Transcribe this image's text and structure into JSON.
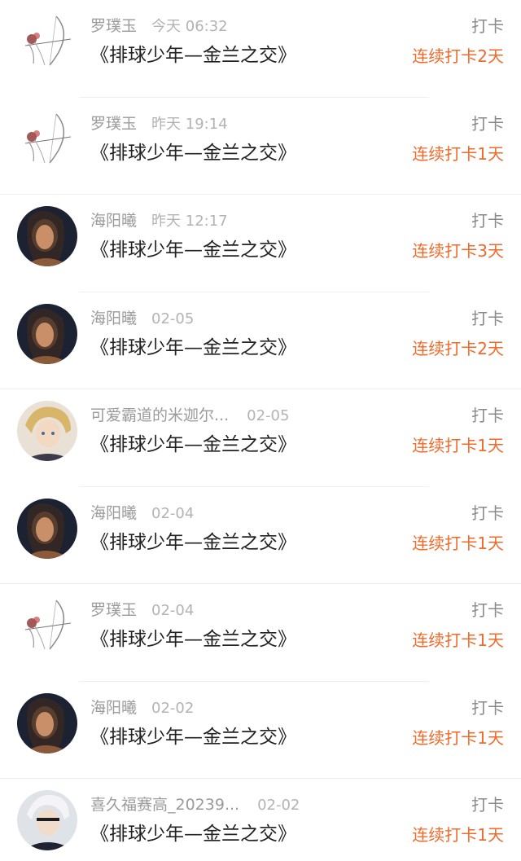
{
  "colors": {
    "streak": "#f06a2a",
    "meta": "#9a9a9a",
    "title": "#222222"
  },
  "records": [
    {
      "user": "罗璞玉",
      "time": "今天 06:32",
      "book": "《排球少年—金兰之交》",
      "type": "打卡",
      "streak": "连续打卡2天",
      "avatar": "archer-sketch-icon"
    },
    {
      "user": "罗璞玉",
      "time": "昨天 19:14",
      "book": "《排球少年—金兰之交》",
      "type": "打卡",
      "streak": "连续打卡1天",
      "avatar": "archer-sketch-icon"
    },
    {
      "user": "海阳曦",
      "time": "昨天 12:17",
      "book": "《排球少年—金兰之交》",
      "type": "打卡",
      "streak": "连续打卡3天",
      "avatar": "portrait-dark-icon"
    },
    {
      "user": "海阳曦",
      "time": "02-05",
      "book": "《排球少年—金兰之交》",
      "type": "打卡",
      "streak": "连续打卡2天",
      "avatar": "portrait-dark-icon"
    },
    {
      "user": "可爱霸道的米迦尔...",
      "time": "02-05",
      "book": "《排球少年—金兰之交》",
      "type": "打卡",
      "streak": "连续打卡1天",
      "avatar": "anime-blond-icon"
    },
    {
      "user": "海阳曦",
      "time": "02-04",
      "book": "《排球少年—金兰之交》",
      "type": "打卡",
      "streak": "连续打卡1天",
      "avatar": "portrait-dark-icon"
    },
    {
      "user": "罗璞玉",
      "time": "02-04",
      "book": "《排球少年—金兰之交》",
      "type": "打卡",
      "streak": "连续打卡1天",
      "avatar": "archer-sketch-icon"
    },
    {
      "user": "海阳曦",
      "time": "02-02",
      "book": "《排球少年—金兰之交》",
      "type": "打卡",
      "streak": "连续打卡1天",
      "avatar": "portrait-dark-icon"
    },
    {
      "user": "喜久福赛高_20239...",
      "time": "02-02",
      "book": "《排球少年—金兰之交》",
      "type": "打卡",
      "streak": "连续打卡1天",
      "avatar": "anime-white-hair-icon"
    }
  ]
}
